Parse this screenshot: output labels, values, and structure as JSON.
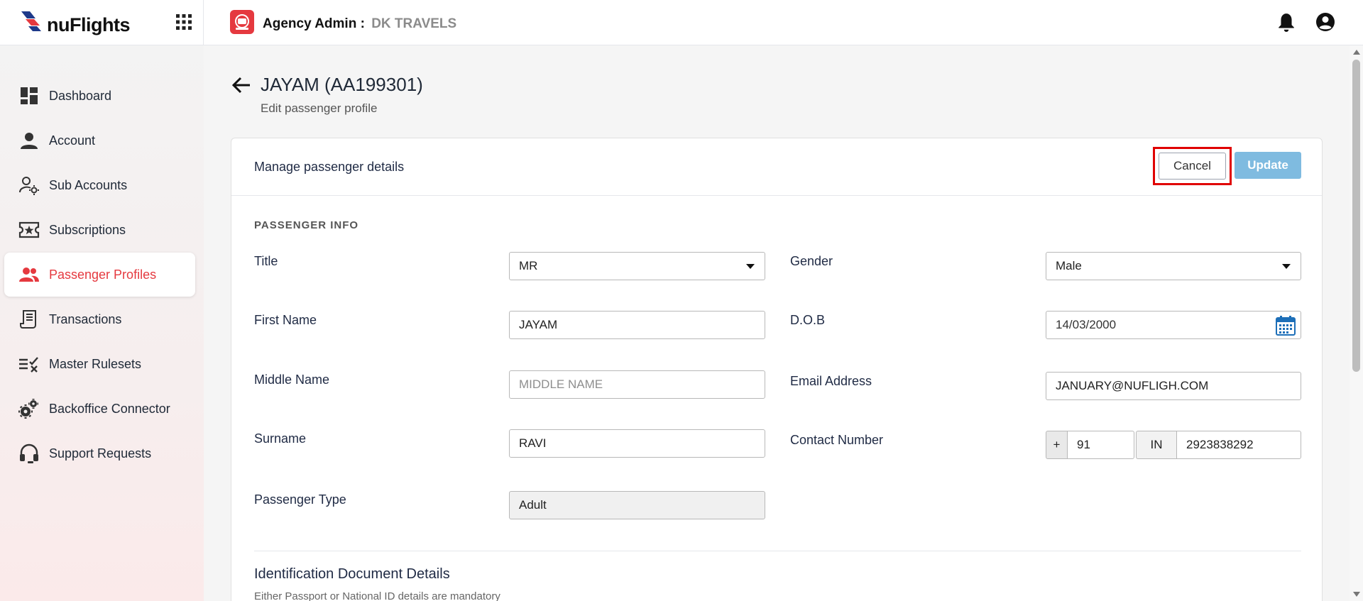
{
  "brand": {
    "name": "nuFlights"
  },
  "header": {
    "agency_label": "Agency Admin :",
    "agency_name": "DK TRAVELS"
  },
  "sidebar": {
    "items": [
      {
        "label": "Dashboard",
        "icon": "dashboard-icon"
      },
      {
        "label": "Account",
        "icon": "person-icon"
      },
      {
        "label": "Sub Accounts",
        "icon": "user-gear-icon"
      },
      {
        "label": "Subscriptions",
        "icon": "ticket-star-icon"
      },
      {
        "label": "Passenger Profiles",
        "icon": "people-icon",
        "active": true
      },
      {
        "label": "Transactions",
        "icon": "receipt-icon"
      },
      {
        "label": "Master Rulesets",
        "icon": "rules-check-icon"
      },
      {
        "label": "Backoffice Connector",
        "icon": "gears-icon"
      },
      {
        "label": "Support Requests",
        "icon": "headset-icon"
      }
    ]
  },
  "page": {
    "title": "JAYAM (AA199301)",
    "subtitle": "Edit passenger profile"
  },
  "card": {
    "header_title": "Manage passenger details",
    "cancel_label": "Cancel",
    "update_label": "Update",
    "section_title": "PASSENGER INFO",
    "fields": {
      "title": {
        "label": "Title",
        "value": "MR"
      },
      "first_name": {
        "label": "First Name",
        "value": "JAYAM"
      },
      "middle_name": {
        "label": "Middle Name",
        "value": "",
        "placeholder": "MIDDLE NAME"
      },
      "surname": {
        "label": "Surname",
        "value": "RAVI"
      },
      "passenger_type": {
        "label": "Passenger Type",
        "value": "Adult"
      },
      "gender": {
        "label": "Gender",
        "value": "Male"
      },
      "dob": {
        "label": "D.O.B",
        "value": "14/03/2000"
      },
      "email": {
        "label": "Email Address",
        "value": "JANUARY@NUFLIGH.COM"
      },
      "contact": {
        "label": "Contact Number",
        "plus": "+",
        "dial_code": "91",
        "country": "IN",
        "number": "2923838292"
      }
    },
    "id_section": {
      "title": "Identification Document Details",
      "note": "Either Passport or National ID details are mandatory"
    }
  },
  "colors": {
    "accent": "#e5393f",
    "update_button": "#7fbbe0",
    "highlight_box": "#e00000"
  }
}
